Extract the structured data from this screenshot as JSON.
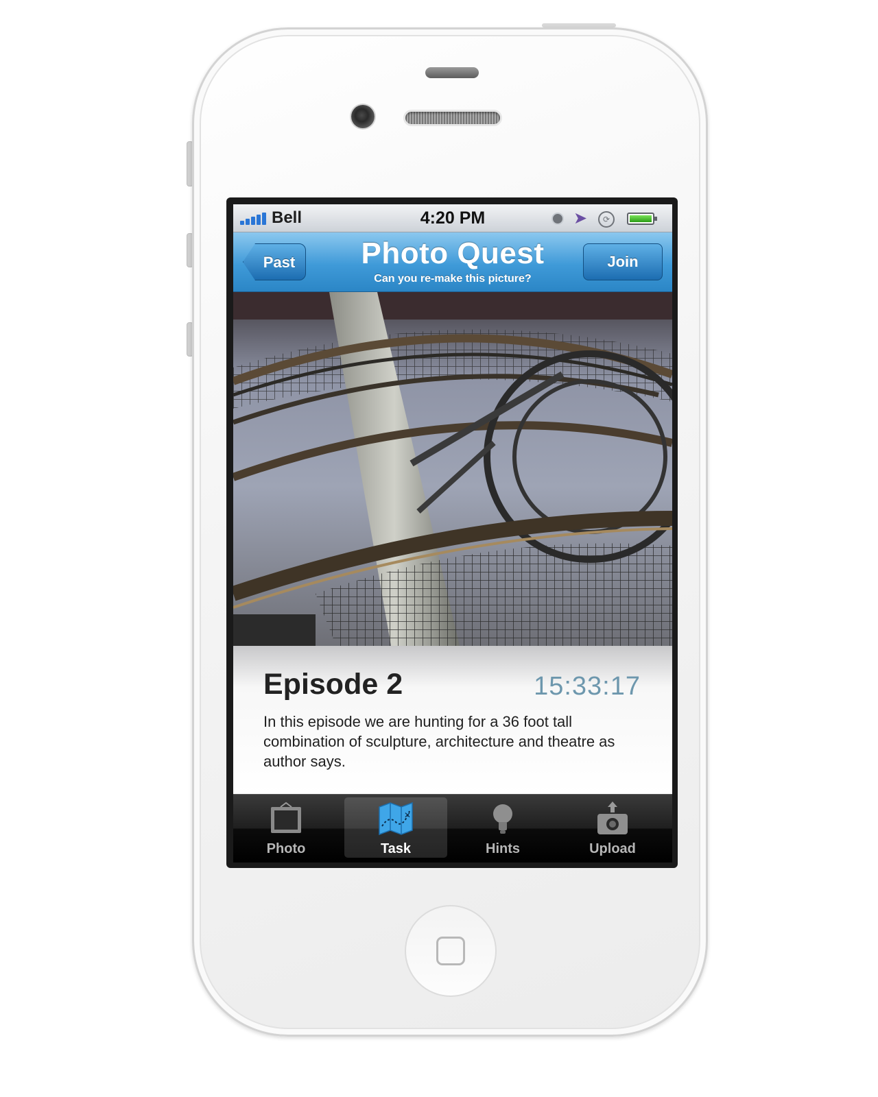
{
  "status_bar": {
    "carrier": "Bell",
    "time": "4:20 PM",
    "icons": [
      "signal-icon",
      "alarm-icon",
      "location-icon",
      "rotation-lock-icon",
      "battery-icon"
    ]
  },
  "nav": {
    "back_label": "Past",
    "title": "Photo Quest",
    "subtitle": "Can you re-make this picture?",
    "action_label": "Join"
  },
  "episode": {
    "title": "Episode 2",
    "timer": "15:33:17",
    "description": "In this episode we are hunting for a 36 foot tall combination of sculpture, architecture and theatre as author says."
  },
  "tabs": [
    {
      "label": "Photo",
      "icon": "photo-frame-icon",
      "selected": false
    },
    {
      "label": "Task",
      "icon": "map-icon",
      "selected": true
    },
    {
      "label": "Hints",
      "icon": "lightbulb-icon",
      "selected": false
    },
    {
      "label": "Upload",
      "icon": "camera-upload-icon",
      "selected": false
    }
  ],
  "colors": {
    "nav_blue": "#3f9ad8",
    "timer": "#6d97ad",
    "signal": "#2a76d6",
    "battery": "#2b9c17"
  }
}
